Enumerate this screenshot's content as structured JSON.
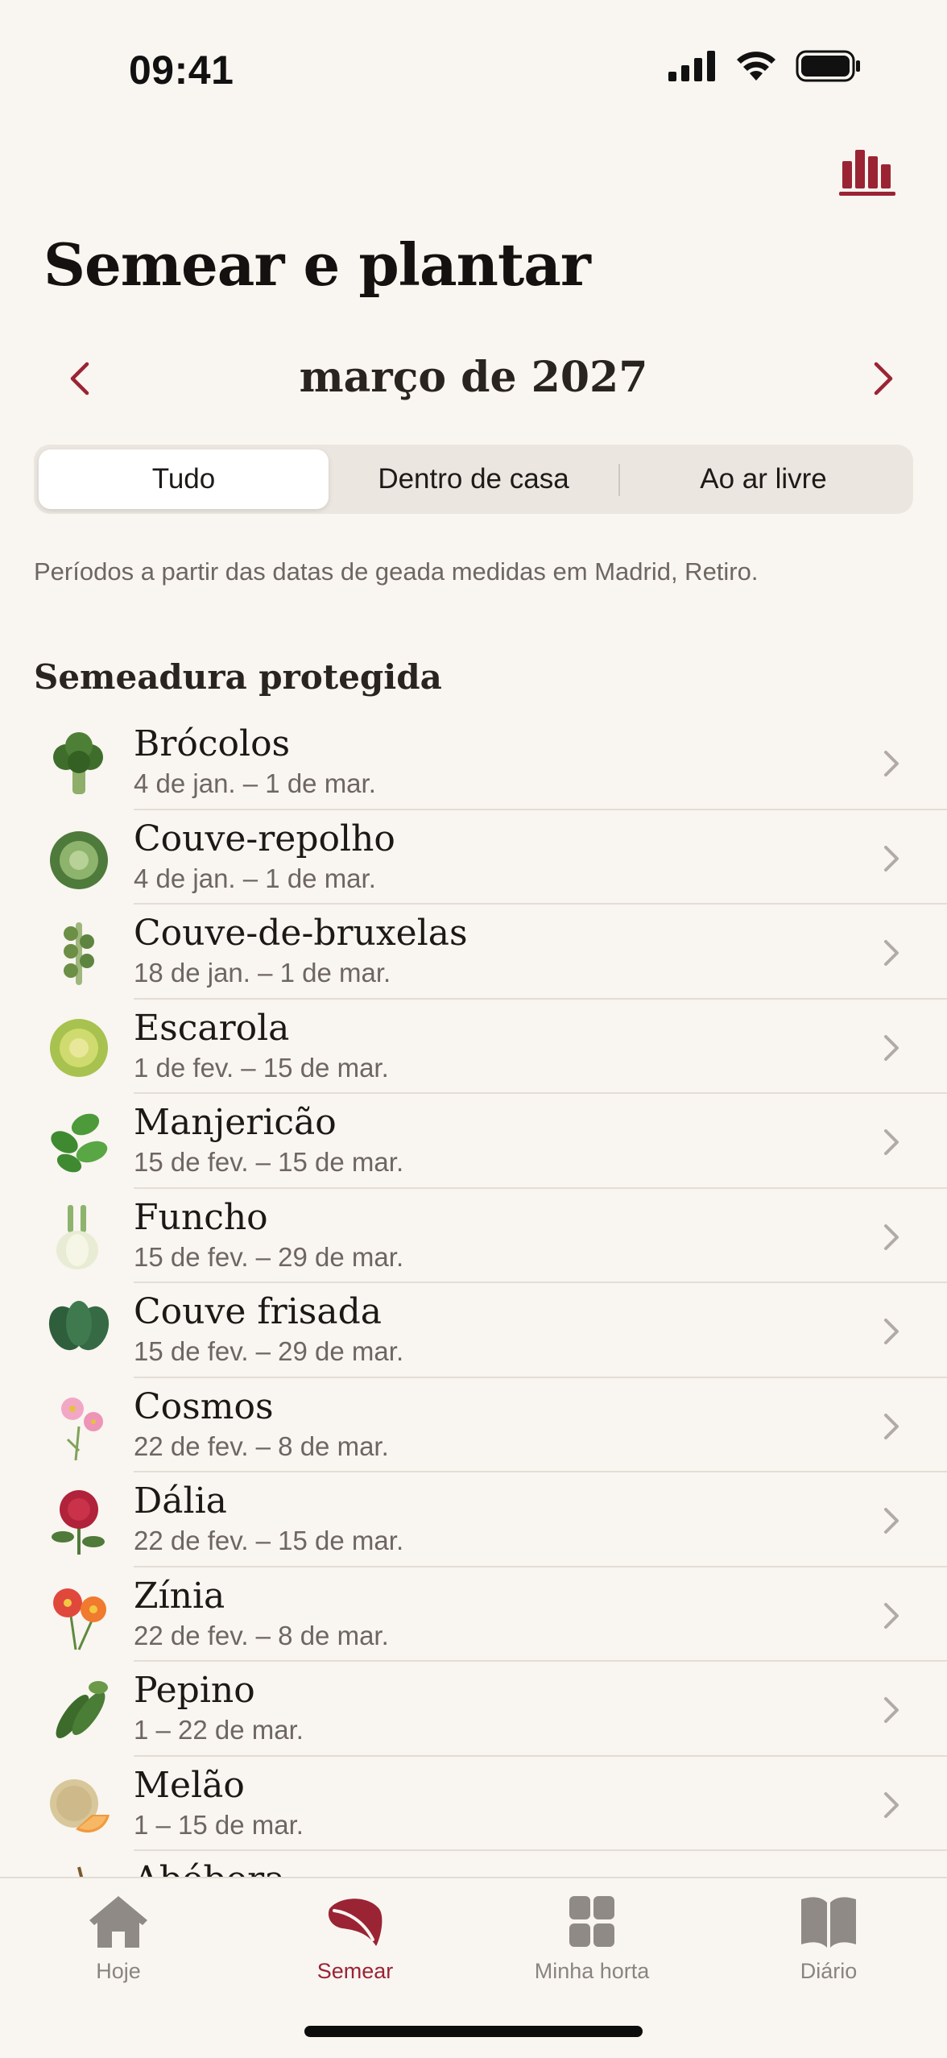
{
  "status": {
    "time": "09:41"
  },
  "header": {
    "title": "Semear e plantar",
    "chart_icon": "chart-bars-icon"
  },
  "month_nav": {
    "label": "março de 2027",
    "prev_icon": "chevron-left-icon",
    "next_icon": "chevron-right-icon"
  },
  "tabs_segment": [
    "Tudo",
    "Dentro de casa",
    "Ao ar livre"
  ],
  "info": "Períodos a partir das datas de geada medidas em Madrid, Retiro.",
  "section": {
    "title": "Semeadura protegida"
  },
  "plants": [
    {
      "name": "Brócolos",
      "dates": "4 de jan. – 1 de mar.",
      "icon": "broccoli-icon"
    },
    {
      "name": "Couve-repolho",
      "dates": "4 de jan. – 1 de mar.",
      "icon": "cabbage-icon"
    },
    {
      "name": "Couve-de-bruxelas",
      "dates": "18 de jan. – 1 de mar.",
      "icon": "brussels-sprouts-icon"
    },
    {
      "name": "Escarola",
      "dates": "1 de fev. – 15 de mar.",
      "icon": "escarole-icon"
    },
    {
      "name": "Manjericão",
      "dates": "15 de fev. – 15 de mar.",
      "icon": "basil-icon"
    },
    {
      "name": "Funcho",
      "dates": "15 de fev. – 29 de mar.",
      "icon": "fennel-icon"
    },
    {
      "name": "Couve frisada",
      "dates": "15 de fev. – 29 de mar.",
      "icon": "kale-icon"
    },
    {
      "name": "Cosmos",
      "dates": "22 de fev. – 8 de mar.",
      "icon": "cosmos-flower-icon"
    },
    {
      "name": "Dália",
      "dates": "22 de fev. – 15 de mar.",
      "icon": "dahlia-icon"
    },
    {
      "name": "Zínia",
      "dates": "22 de fev. – 8 de mar.",
      "icon": "zinnia-icon"
    },
    {
      "name": "Pepino",
      "dates": "1 – 22 de mar.",
      "icon": "cucumber-icon"
    },
    {
      "name": "Melão",
      "dates": "1 – 15 de mar.",
      "icon": "melon-icon"
    },
    {
      "name": "Abóbora",
      "dates": "",
      "icon": "pumpkin-icon"
    }
  ],
  "tab_bar": [
    {
      "label": "Hoje",
      "icon": "house-icon",
      "active": false
    },
    {
      "label": "Semear",
      "icon": "leaf-icon",
      "active": true
    },
    {
      "label": "Minha horta",
      "icon": "grid-icon",
      "active": false
    },
    {
      "label": "Diário",
      "icon": "book-icon",
      "active": false
    }
  ],
  "colors": {
    "accent": "#9a2434",
    "background": "#f9f5f0",
    "secondary_text": "#6e6661"
  }
}
